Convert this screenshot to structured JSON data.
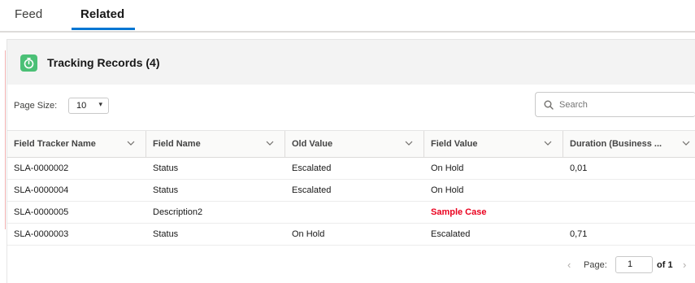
{
  "tabs": [
    {
      "label": "Feed",
      "active": false
    },
    {
      "label": "Related",
      "active": true
    }
  ],
  "card": {
    "title": "Tracking Records (4)",
    "icon": "stopwatch-icon",
    "icon_color": "#4bc076"
  },
  "page_size": {
    "label": "Page Size:",
    "value": "10"
  },
  "search": {
    "placeholder": "Search",
    "value": ""
  },
  "table": {
    "columns": [
      "Field Tracker Name",
      "Field Name",
      "Old Value",
      "Field Value",
      "Duration (Business ..."
    ],
    "rows": [
      {
        "name": "SLA-0000002",
        "field": "Status",
        "old": "Escalated",
        "value": "On Hold",
        "duration": "0,01",
        "highlight": false
      },
      {
        "name": "SLA-0000004",
        "field": "Status",
        "old": "Escalated",
        "value": "On Hold",
        "duration": "",
        "highlight": false
      },
      {
        "name": "SLA-0000005",
        "field": "Description2",
        "old": "",
        "value": "Sample Case",
        "duration": "",
        "highlight": true
      },
      {
        "name": "SLA-0000003",
        "field": "Status",
        "old": "On Hold",
        "value": "Escalated",
        "duration": "0,71",
        "highlight": false
      }
    ]
  },
  "pager": {
    "label": "Page:",
    "current": "1",
    "of_text": "of 1"
  },
  "colors": {
    "accent": "#0176d3",
    "highlight_red": "#ea001e"
  }
}
